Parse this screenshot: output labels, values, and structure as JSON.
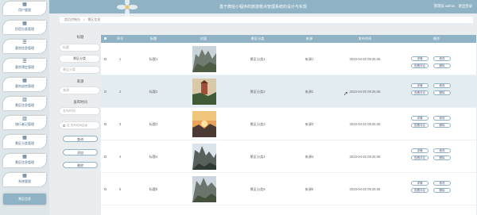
{
  "header": {
    "title": "基于微信小程序的旅游景点管理系统的设计与实现",
    "user_text": "管理员 admin　退出登录"
  },
  "sidebar": {
    "items": [
      {
        "label": "用户管理",
        "icon": "grid-icon"
      },
      {
        "label": "民宿分类管理",
        "icon": "grid-icon"
      },
      {
        "label": "客房信息管理",
        "icon": "list-icon"
      },
      {
        "label": "客房预定管理",
        "icon": "list-icon"
      },
      {
        "label": "客房退房管理",
        "icon": "grid-icon"
      },
      {
        "label": "景区信息管理",
        "icon": "chart-icon"
      },
      {
        "label": "旅行者记管理",
        "icon": "chart-icon"
      },
      {
        "label": "景区分类管理",
        "icon": "grid-icon"
      },
      {
        "label": "景区信息管理",
        "icon": "grid-icon"
      },
      {
        "label": "系统管理",
        "icon": "grid-icon"
      }
    ]
  },
  "breadcrumb": {
    "home": "首页控制台",
    "current": "景区信息"
  },
  "search": {
    "title_label": "标题",
    "title_placeholder": "标题",
    "category_label": "景区分类",
    "category_placeholder": "景区分类",
    "source_label": "来源",
    "source_placeholder": "来源",
    "time_label": "发布时间",
    "time_placeholder": "发布时间",
    "time_end_placeholder": "至 发布时间结束",
    "search_button": "查询",
    "add_button": "添加",
    "delete_button": "删除"
  },
  "table": {
    "columns": [
      "",
      "序号",
      "标题",
      "封面",
      "景区分类",
      "来源",
      "发布时间",
      "操作"
    ],
    "rows": [
      {
        "index": "1",
        "title": "标题1",
        "category": "景区分类1",
        "source": "来源1",
        "time": "2023-04-20 09:25:36"
      },
      {
        "index": "2",
        "title": "标题2",
        "category": "景区分类2",
        "source": "来源2",
        "time": "2023-04-20 09:25:36"
      },
      {
        "index": "3",
        "title": "标题3",
        "category": "景区分类3",
        "source": "来源3",
        "time": "2023-04-20 09:25:36"
      },
      {
        "index": "4",
        "title": "标题4",
        "category": "景区分类4",
        "source": "来源4",
        "time": "2023-04-20 09:25:36"
      },
      {
        "index": "5",
        "title": "标题5",
        "category": "景区分类5",
        "source": "来源5",
        "time": "2023-04-20 09:25:36"
      }
    ],
    "actions": {
      "detail": "详情",
      "edit": "修改",
      "comment": "查看评论",
      "delete": "删除"
    }
  },
  "colors": {
    "accent": "#8fb3c4",
    "sidebar_bg": "#dfe6ea",
    "row_shade": "#e3ecf1"
  }
}
